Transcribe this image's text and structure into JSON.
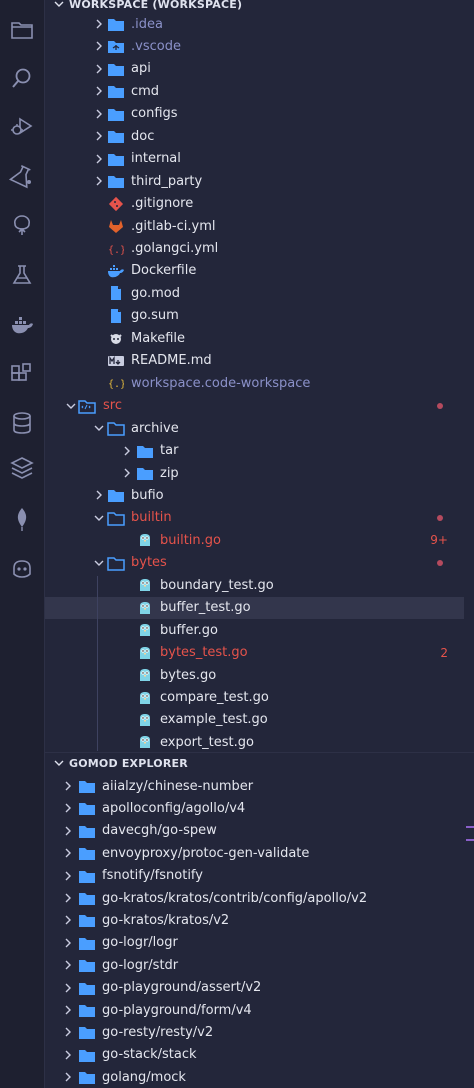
{
  "colors": {
    "folder": "#4a9eff",
    "red": "#e5534b",
    "dimmed": "#8b91c9",
    "yellow": "#e2b93d",
    "gopher": "#7fd3e6"
  },
  "activity_bar": [
    "explorer-icon",
    "search-icon",
    "run-debug-icon",
    "extensions-test-icon",
    "source-tree-icon",
    "flask-icon",
    "docker-icon",
    "extensions-icon",
    "database-icon",
    "layers-icon",
    "mongodb-leaf-icon",
    "copilot-icon"
  ],
  "workspace": {
    "header": "WORKSPACE (WORKSPACE)",
    "rows": [
      {
        "label": ".idea",
        "kind": "folder",
        "depth": 1,
        "color": "dimmed",
        "expanded": false
      },
      {
        "label": ".vscode",
        "kind": "vscode",
        "depth": 1,
        "color": "dimmed",
        "expanded": false
      },
      {
        "label": "api",
        "kind": "folder",
        "depth": 1,
        "expanded": false
      },
      {
        "label": "cmd",
        "kind": "folder",
        "depth": 1,
        "expanded": false
      },
      {
        "label": "configs",
        "kind": "folder",
        "depth": 1,
        "expanded": false
      },
      {
        "label": "doc",
        "kind": "folder",
        "depth": 1,
        "expanded": false
      },
      {
        "label": "internal",
        "kind": "folder",
        "depth": 1,
        "expanded": false
      },
      {
        "label": "third_party",
        "kind": "folder",
        "depth": 1,
        "expanded": false
      },
      {
        "label": ".gitignore",
        "kind": "git",
        "depth": 1
      },
      {
        "label": ".gitlab-ci.yml",
        "kind": "gitlab",
        "depth": 1
      },
      {
        "label": ".golangci.yml",
        "kind": "yaml",
        "depth": 1
      },
      {
        "label": "Dockerfile",
        "kind": "docker",
        "depth": 1
      },
      {
        "label": "go.mod",
        "kind": "file",
        "depth": 1
      },
      {
        "label": "go.sum",
        "kind": "file",
        "depth": 1
      },
      {
        "label": "Makefile",
        "kind": "makefile",
        "depth": 1
      },
      {
        "label": "README.md",
        "kind": "markdown",
        "depth": 1
      },
      {
        "label": "workspace.code-workspace",
        "kind": "json",
        "depth": 1,
        "color": "dimmed"
      },
      {
        "label": "src",
        "kind": "src-folder",
        "depth": 0,
        "color": "red",
        "expanded": true,
        "dot": true
      },
      {
        "label": "archive",
        "kind": "folder-open",
        "depth": 1,
        "expanded": true
      },
      {
        "label": "tar",
        "kind": "folder",
        "depth": 2,
        "expanded": false
      },
      {
        "label": "zip",
        "kind": "folder",
        "depth": 2,
        "expanded": false
      },
      {
        "label": "bufio",
        "kind": "folder",
        "depth": 1,
        "expanded": false
      },
      {
        "label": "builtin",
        "kind": "folder-open",
        "depth": 1,
        "color": "red",
        "expanded": true,
        "dot": true
      },
      {
        "label": "builtin.go",
        "kind": "go",
        "depth": 2,
        "color": "red",
        "badge": "9+"
      },
      {
        "label": "bytes",
        "kind": "folder-open",
        "depth": 1,
        "color": "red",
        "expanded": true,
        "dot": true
      },
      {
        "label": "boundary_test.go",
        "kind": "go",
        "depth": 2
      },
      {
        "label": "buffer_test.go",
        "kind": "go",
        "depth": 2,
        "selected": true
      },
      {
        "label": "buffer.go",
        "kind": "go",
        "depth": 2
      },
      {
        "label": "bytes_test.go",
        "kind": "go",
        "depth": 2,
        "color": "red",
        "badge": "2"
      },
      {
        "label": "bytes.go",
        "kind": "go",
        "depth": 2
      },
      {
        "label": "compare_test.go",
        "kind": "go",
        "depth": 2
      },
      {
        "label": "example_test.go",
        "kind": "go",
        "depth": 2
      },
      {
        "label": "export_test.go",
        "kind": "go",
        "depth": 2
      }
    ]
  },
  "gomod": {
    "header": "GOMOD EXPLORER",
    "modules": [
      "aiialzy/chinese-number",
      "apolloconfig/agollo/v4",
      "davecgh/go-spew",
      "envoyproxy/protoc-gen-validate",
      "fsnotify/fsnotify",
      "go-kratos/kratos/contrib/config/apollo/v2",
      "go-kratos/kratos/v2",
      "go-logr/logr",
      "go-logr/stdr",
      "go-playground/assert/v2",
      "go-playground/form/v4",
      "go-resty/resty/v2",
      "go-stack/stack",
      "golang/mock"
    ]
  }
}
